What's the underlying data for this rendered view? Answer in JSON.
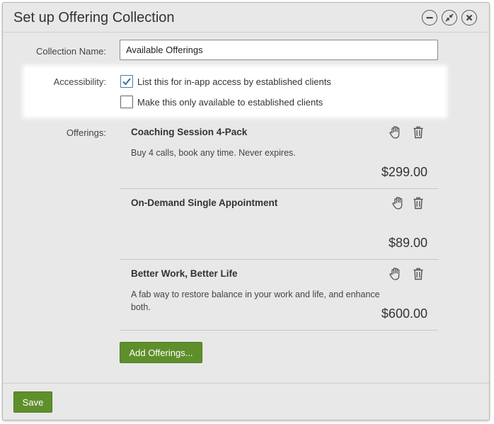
{
  "dialog": {
    "title": "Set up Offering Collection"
  },
  "window_controls": {
    "minimize_icon": "minimize-icon",
    "collapse_icon": "collapse-icon",
    "close_icon": "close-icon"
  },
  "form": {
    "collection_name_label": "Collection Name:",
    "collection_name_value": "Available Offerings",
    "accessibility_label": "Accessibility:",
    "options": [
      {
        "label": "List this for in-app access by established clients",
        "checked": true
      },
      {
        "label": "Make this only available to established clients",
        "checked": false
      }
    ],
    "offerings_label": "Offerings:"
  },
  "offerings": [
    {
      "name": "Coaching Session 4-Pack",
      "description": "Buy 4 calls, book any time. Never expires.",
      "price": "$299.00"
    },
    {
      "name": "On-Demand Single Appointment",
      "description": "",
      "price": "$89.00"
    },
    {
      "name": "Better Work, Better Life",
      "description": "A fab way to restore balance in your work and life, and enhance both.",
      "price": "$600.00"
    }
  ],
  "buttons": {
    "add_offerings": "Add Offerings...",
    "save": "Save"
  },
  "colors": {
    "accent_green": "#5f8f2b",
    "check_blue": "#3d6f95",
    "dialog_bg": "#e8e8e8"
  }
}
